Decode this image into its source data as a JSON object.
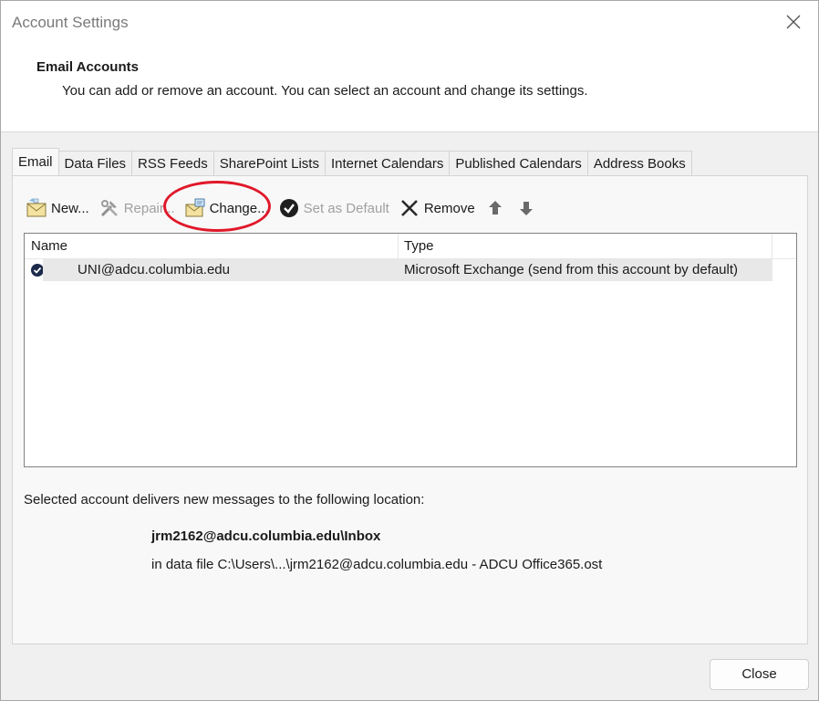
{
  "window": {
    "title": "Account Settings"
  },
  "header": {
    "title": "Email Accounts",
    "description": "You can add or remove an account. You can select an account and change its settings."
  },
  "tabs": [
    {
      "label": "Email",
      "active": true
    },
    {
      "label": "Data Files"
    },
    {
      "label": "RSS Feeds"
    },
    {
      "label": "SharePoint Lists"
    },
    {
      "label": "Internet Calendars"
    },
    {
      "label": "Published Calendars"
    },
    {
      "label": "Address Books"
    }
  ],
  "toolbar": {
    "new_label": "New...",
    "repair_label": "Repair...",
    "change_label": "Change...",
    "set_default_label": "Set as Default",
    "remove_label": "Remove",
    "annotation_color": "#e0182a"
  },
  "accounts": {
    "columns": {
      "name": "Name",
      "type": "Type"
    },
    "rows": [
      {
        "name": "UNI@adcu.columbia.edu",
        "type": "Microsoft Exchange (send from this account by default)"
      }
    ]
  },
  "delivery": {
    "label": "Selected account delivers new messages to the following location:",
    "folder": "jrm2162@adcu.columbia.edu\\Inbox",
    "data_file": "in data file C:\\Users\\...\\jrm2162@adcu.columbia.edu - ADCU Office365.ost"
  },
  "footer": {
    "close_label": "Close"
  }
}
